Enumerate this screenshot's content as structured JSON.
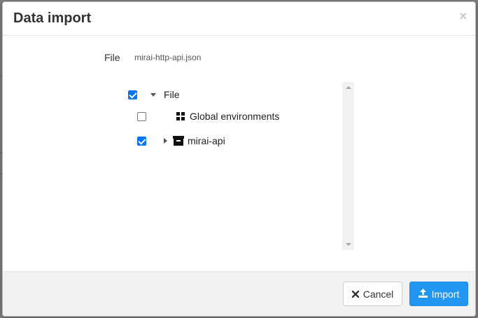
{
  "dialog": {
    "title": "Data import",
    "close_glyph": "×"
  },
  "file": {
    "label": "File",
    "value": "mirai-http-api.json"
  },
  "tree": {
    "root": {
      "label": "File",
      "checked": true,
      "expanded": true
    },
    "items": [
      {
        "label": "Global environments",
        "checked": false,
        "icon": "grid-icon"
      },
      {
        "label": "mirai-api",
        "checked": true,
        "icon": "box-icon",
        "collapsed": true
      }
    ]
  },
  "footer": {
    "cancel_label": "Cancel",
    "import_label": "Import"
  },
  "colors": {
    "accent": "#2196f3",
    "checkbox": "#0075ff"
  }
}
